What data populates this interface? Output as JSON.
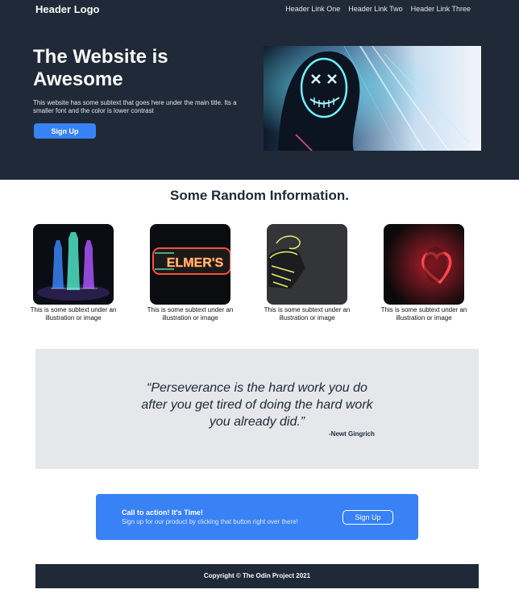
{
  "header": {
    "logo": "Header Logo",
    "nav": [
      "Header Link One",
      "Header Link Two",
      "Header Link Three"
    ]
  },
  "hero": {
    "title": "The Website is Awesome",
    "subtitle": "This website has some subtext that goes here under the main title. Its a smaller font and the color is lower contrast",
    "button": "Sign Up",
    "image_icon": "neon-mask-icon"
  },
  "info": {
    "title": "Some Random Information.",
    "cards": [
      {
        "icon": "neon-bottles-icon",
        "caption": "This is some subtext under an illustration or image"
      },
      {
        "icon": "neon-sign-elmers-icon",
        "sign_text": "ELMER'S",
        "caption": "This is some subtext under an illustration or image"
      },
      {
        "icon": "neon-frozen-star-sign-icon",
        "caption": "This is some subtext under an illustration or image"
      },
      {
        "icon": "neon-heart-icon",
        "caption": "This is some subtext under an illustration or image"
      }
    ]
  },
  "quote": {
    "text": "“Perseverance is the hard work you do after you get tired of doing the hard work you already did.”",
    "author": "-Newt Gingrich"
  },
  "cta": {
    "title": "Call to action! It's Time!",
    "subtitle": "Sign up for our product by clicking that button right over there!",
    "button": "Sign Up"
  },
  "footer": {
    "text": "Copyright © The Odin Project 2021"
  },
  "colors": {
    "dark": "#1f2937",
    "accent": "#3882f6",
    "light": "#e5e7eb"
  }
}
